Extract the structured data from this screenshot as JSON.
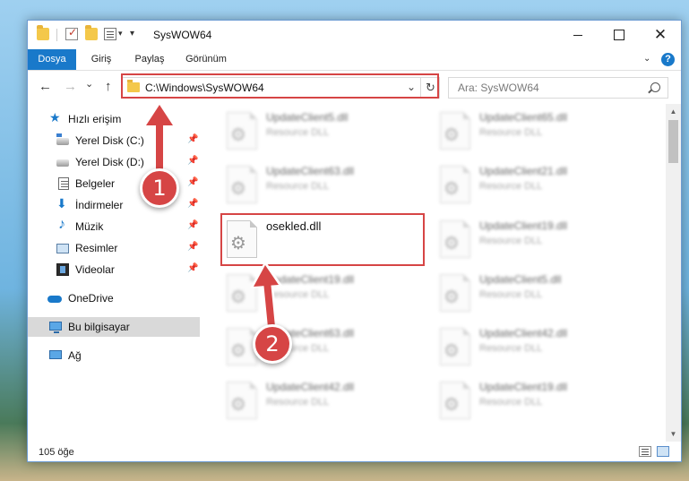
{
  "window": {
    "title": "SysWOW64",
    "controls": {
      "minimize": "",
      "maximize": "",
      "close": "✕"
    }
  },
  "ribbon": {
    "tabs": [
      {
        "label": "Dosya"
      },
      {
        "label": "Giriş"
      },
      {
        "label": "Paylaş"
      },
      {
        "label": "Görünüm"
      }
    ],
    "help": "?"
  },
  "nav": {
    "back": "←",
    "forward": "→",
    "recent": "⌄",
    "up": "↑",
    "address": "C:\\Windows\\SysWOW64",
    "address_drop": "⌄",
    "refresh": "↻",
    "search_placeholder": "Ara: SysWOW64"
  },
  "sidebar": {
    "items": [
      {
        "label": "Hızlı erişim",
        "icon": "star-icon"
      },
      {
        "label": "Yerel Disk (C:)",
        "icon": "disk-icon",
        "pinned": true
      },
      {
        "label": "Yerel Disk (D:)",
        "icon": "disk-icon",
        "pinned": true
      },
      {
        "label": "Belgeler",
        "icon": "document-icon",
        "pinned": true
      },
      {
        "label": "İndirmeler",
        "icon": "download-icon",
        "pinned": true
      },
      {
        "label": "Müzik",
        "icon": "music-icon",
        "pinned": true
      },
      {
        "label": "Resimler",
        "icon": "picture-icon",
        "pinned": true
      },
      {
        "label": "Videolar",
        "icon": "video-icon",
        "pinned": true
      },
      {
        "label": "OneDrive",
        "icon": "cloud-icon"
      },
      {
        "label": "Bu bilgisayar",
        "icon": "computer-icon",
        "selected": true
      },
      {
        "label": "Ağ",
        "icon": "network-icon"
      }
    ],
    "pin_glyph": "📌"
  },
  "files": {
    "left": [
      {
        "name": "UpdateClient5.dll",
        "type": "Resource DLL"
      },
      {
        "name": "UpdateClient63.dll",
        "type": "Resource DLL"
      },
      {
        "name": "osekled.dll",
        "type": ""
      },
      {
        "name": "UpdateClient19.dll",
        "type": "Resource DLL"
      },
      {
        "name": "UpdateClient63.dll",
        "type": "Resource DLL"
      },
      {
        "name": "UpdateClient42.dll",
        "type": "Resource DLL"
      }
    ],
    "right": [
      {
        "name": "UpdateClient65.dll",
        "type": "Resource DLL"
      },
      {
        "name": "UpdateClient21.dll",
        "type": "Resource DLL"
      },
      {
        "name": "UpdateClient19.dll",
        "type": "Resource DLL"
      },
      {
        "name": "UpdateClient5.dll",
        "type": "Resource DLL"
      },
      {
        "name": "UpdateClient42.dll",
        "type": "Resource DLL"
      },
      {
        "name": "UpdateClient19.dll",
        "type": "Resource DLL"
      }
    ]
  },
  "status": {
    "count": "105 öğe"
  },
  "annotations": {
    "step1": "1",
    "step2": "2",
    "color": "#d64545"
  }
}
